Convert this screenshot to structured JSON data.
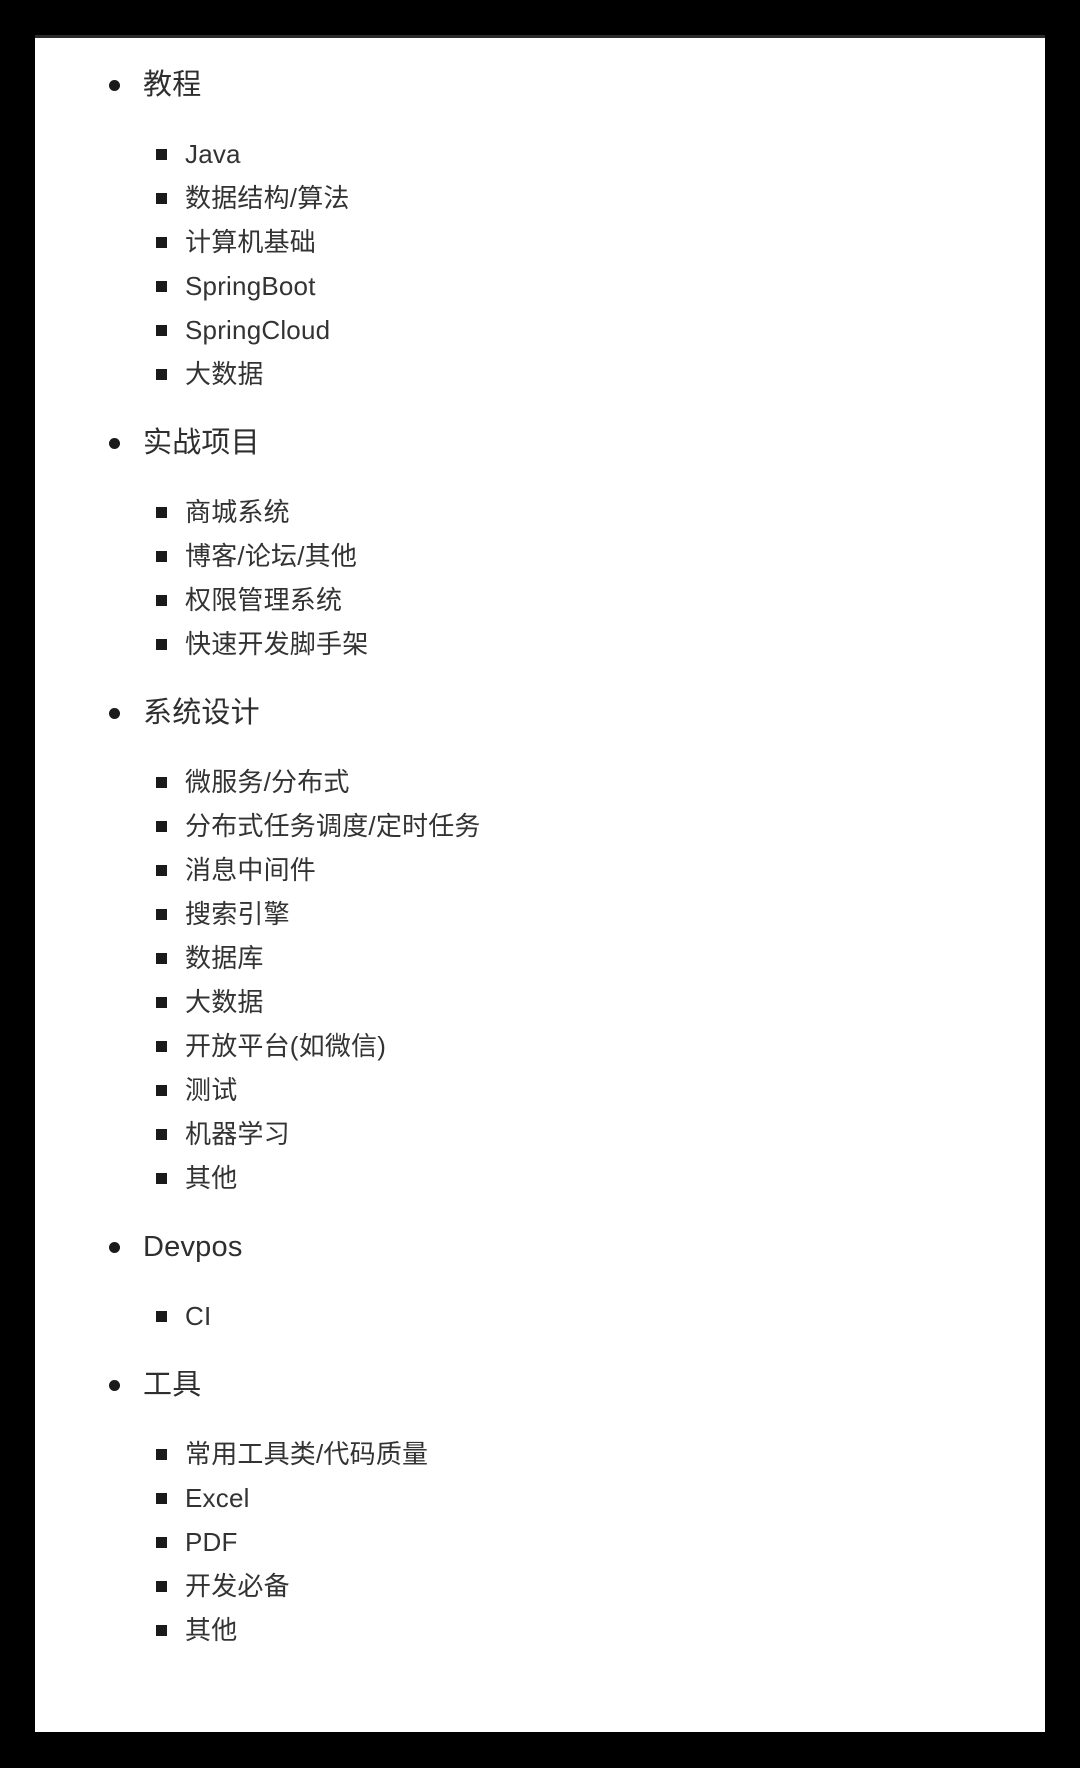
{
  "document": {
    "type": "nested-outline-list",
    "background_color": "#000000",
    "card_color": "#ffffff",
    "text_color": "#333333",
    "bullet_color": "#1a1a1a",
    "level1_bullet_glyph": "•",
    "level2_bullet_glyph": "▪"
  },
  "outline": [
    {
      "label": "教程",
      "children": [
        {
          "label": "Java"
        },
        {
          "label": "数据结构/算法"
        },
        {
          "label": "计算机基础"
        },
        {
          "label": "SpringBoot"
        },
        {
          "label": "SpringCloud"
        },
        {
          "label": "大数据"
        }
      ]
    },
    {
      "label": "实战项目",
      "children": [
        {
          "label": "商城系统"
        },
        {
          "label": "博客/论坛/其他"
        },
        {
          "label": "权限管理系统"
        },
        {
          "label": "快速开发脚手架"
        }
      ]
    },
    {
      "label": "系统设计",
      "children": [
        {
          "label": "微服务/分布式"
        },
        {
          "label": "分布式任务调度/定时任务"
        },
        {
          "label": "消息中间件"
        },
        {
          "label": "搜索引擎"
        },
        {
          "label": "数据库"
        },
        {
          "label": "大数据"
        },
        {
          "label": "开放平台(如微信)"
        },
        {
          "label": "测试"
        },
        {
          "label": "机器学习"
        },
        {
          "label": "其他"
        }
      ]
    },
    {
      "label": "Devpos",
      "children": [
        {
          "label": "CI"
        }
      ]
    },
    {
      "label": "工具",
      "children": [
        {
          "label": "常用工具类/代码质量"
        },
        {
          "label": "Excel"
        },
        {
          "label": "PDF"
        },
        {
          "label": "开发必备"
        },
        {
          "label": "其他"
        }
      ]
    }
  ]
}
